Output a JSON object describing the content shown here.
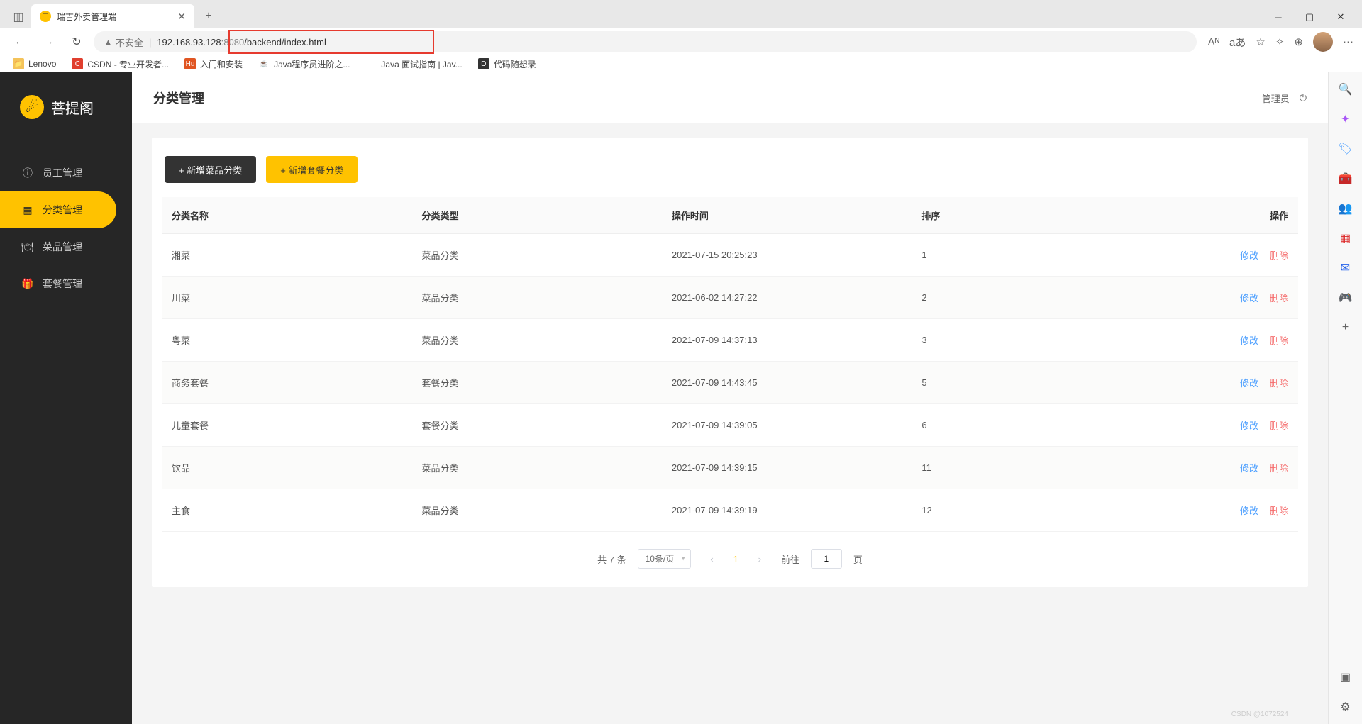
{
  "browser": {
    "tab_title": "瑞吉外卖管理端",
    "url_insecure": "不安全",
    "url_host": "192.168.93.128",
    "url_port": ":8080",
    "url_path": "/backend/index.html"
  },
  "bookmarks": [
    {
      "label": "Lenovo",
      "icon": "📁",
      "bg": "#f4c35a"
    },
    {
      "label": "CSDN - 专业开发者...",
      "icon": "C",
      "bg": "#e03f2f"
    },
    {
      "label": "入门和安装",
      "icon": "Hu",
      "bg": "#e05522"
    },
    {
      "label": "Java程序员进阶之...",
      "icon": "☕",
      "bg": "#fff"
    },
    {
      "label": "Java 面试指南 | Jav...",
      "icon": "·",
      "bg": "#fff"
    },
    {
      "label": "代码随想录",
      "icon": "D",
      "bg": "#333"
    }
  ],
  "app": {
    "logo_text": "菩提阁",
    "page_title": "分类管理",
    "admin_label": "管理员"
  },
  "sidebar": {
    "items": [
      {
        "label": "员工管理",
        "active": false
      },
      {
        "label": "分类管理",
        "active": true
      },
      {
        "label": "菜品管理",
        "active": false
      },
      {
        "label": "套餐管理",
        "active": false
      }
    ]
  },
  "actions": {
    "add_dish": "+ 新增菜品分类",
    "add_meal": "+ 新增套餐分类"
  },
  "table": {
    "headers": {
      "name": "分类名称",
      "type": "分类类型",
      "time": "操作时间",
      "sort": "排序",
      "op": "操作"
    },
    "edit_label": "修改",
    "delete_label": "删除",
    "rows": [
      {
        "name": "湘菜",
        "type": "菜品分类",
        "time": "2021-07-15 20:25:23",
        "sort": "1"
      },
      {
        "name": "川菜",
        "type": "菜品分类",
        "time": "2021-06-02 14:27:22",
        "sort": "2"
      },
      {
        "name": "粤菜",
        "type": "菜品分类",
        "time": "2021-07-09 14:37:13",
        "sort": "3"
      },
      {
        "name": "商务套餐",
        "type": "套餐分类",
        "time": "2021-07-09 14:43:45",
        "sort": "5"
      },
      {
        "name": "儿童套餐",
        "type": "套餐分类",
        "time": "2021-07-09 14:39:05",
        "sort": "6"
      },
      {
        "name": "饮品",
        "type": "菜品分类",
        "time": "2021-07-09 14:39:15",
        "sort": "11"
      },
      {
        "name": "主食",
        "type": "菜品分类",
        "time": "2021-07-09 14:39:19",
        "sort": "12"
      }
    ]
  },
  "pagination": {
    "total": "共 7 条",
    "per_page": "10条/页",
    "current": "1",
    "goto_prefix": "前往",
    "goto_value": "1",
    "goto_suffix": "页"
  },
  "watermark": "CSDN @1072524"
}
